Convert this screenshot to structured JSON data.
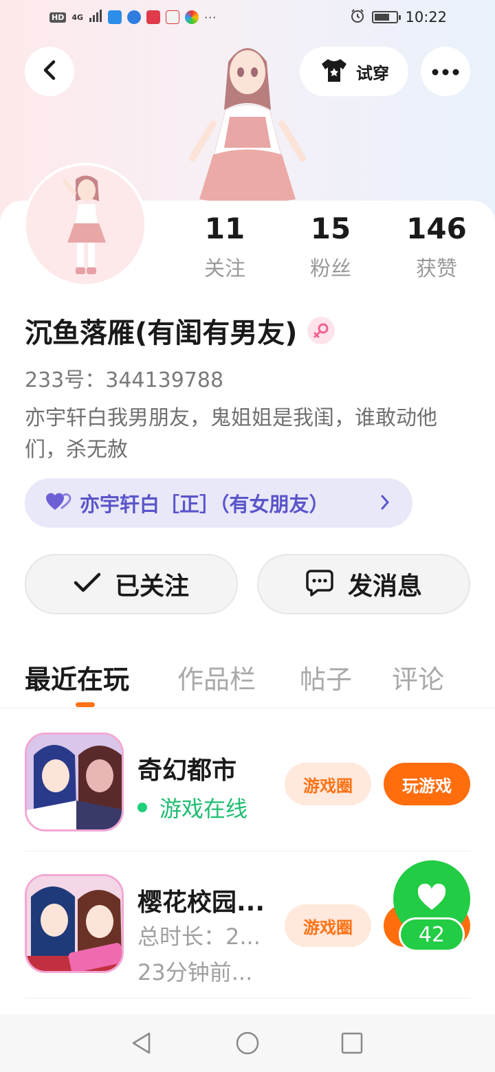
{
  "status_bar": {
    "time": "10:22",
    "network": "4G",
    "hd": "HD",
    "more": "···"
  },
  "header": {
    "try_on_label": "试穿"
  },
  "profile": {
    "stats": [
      {
        "value": "11",
        "label": "关注"
      },
      {
        "value": "15",
        "label": "粉丝"
      },
      {
        "value": "146",
        "label": "获赞"
      }
    ],
    "nickname": "沉鱼落雁(有闺有男友)",
    "uid": "233号：344139788",
    "bio": "亦宇轩白我男朋友，鬼姐姐是我闺，谁敢动他们，杀无赦",
    "relation": "亦宇轩白［正］（有女朋友）",
    "follow_label": "已关注",
    "message_label": "发消息"
  },
  "tabs": [
    "最近在玩",
    "作品栏",
    "帖子",
    "评论"
  ],
  "games": [
    {
      "name": "奇幻都市",
      "status": "游戏在线",
      "circle_label": "游戏圈",
      "play_label": "玩游戏"
    },
    {
      "name": "樱花校园...",
      "duration": "总时长：2...",
      "last_played": "23分钟前...",
      "circle_label": "游戏圈"
    }
  ],
  "floating_like": {
    "count": "42"
  },
  "colors": {
    "accent": "#ff7214",
    "online": "#1fbc71",
    "relation_text": "#5a55c9",
    "like_bubble": "#22cc44"
  }
}
